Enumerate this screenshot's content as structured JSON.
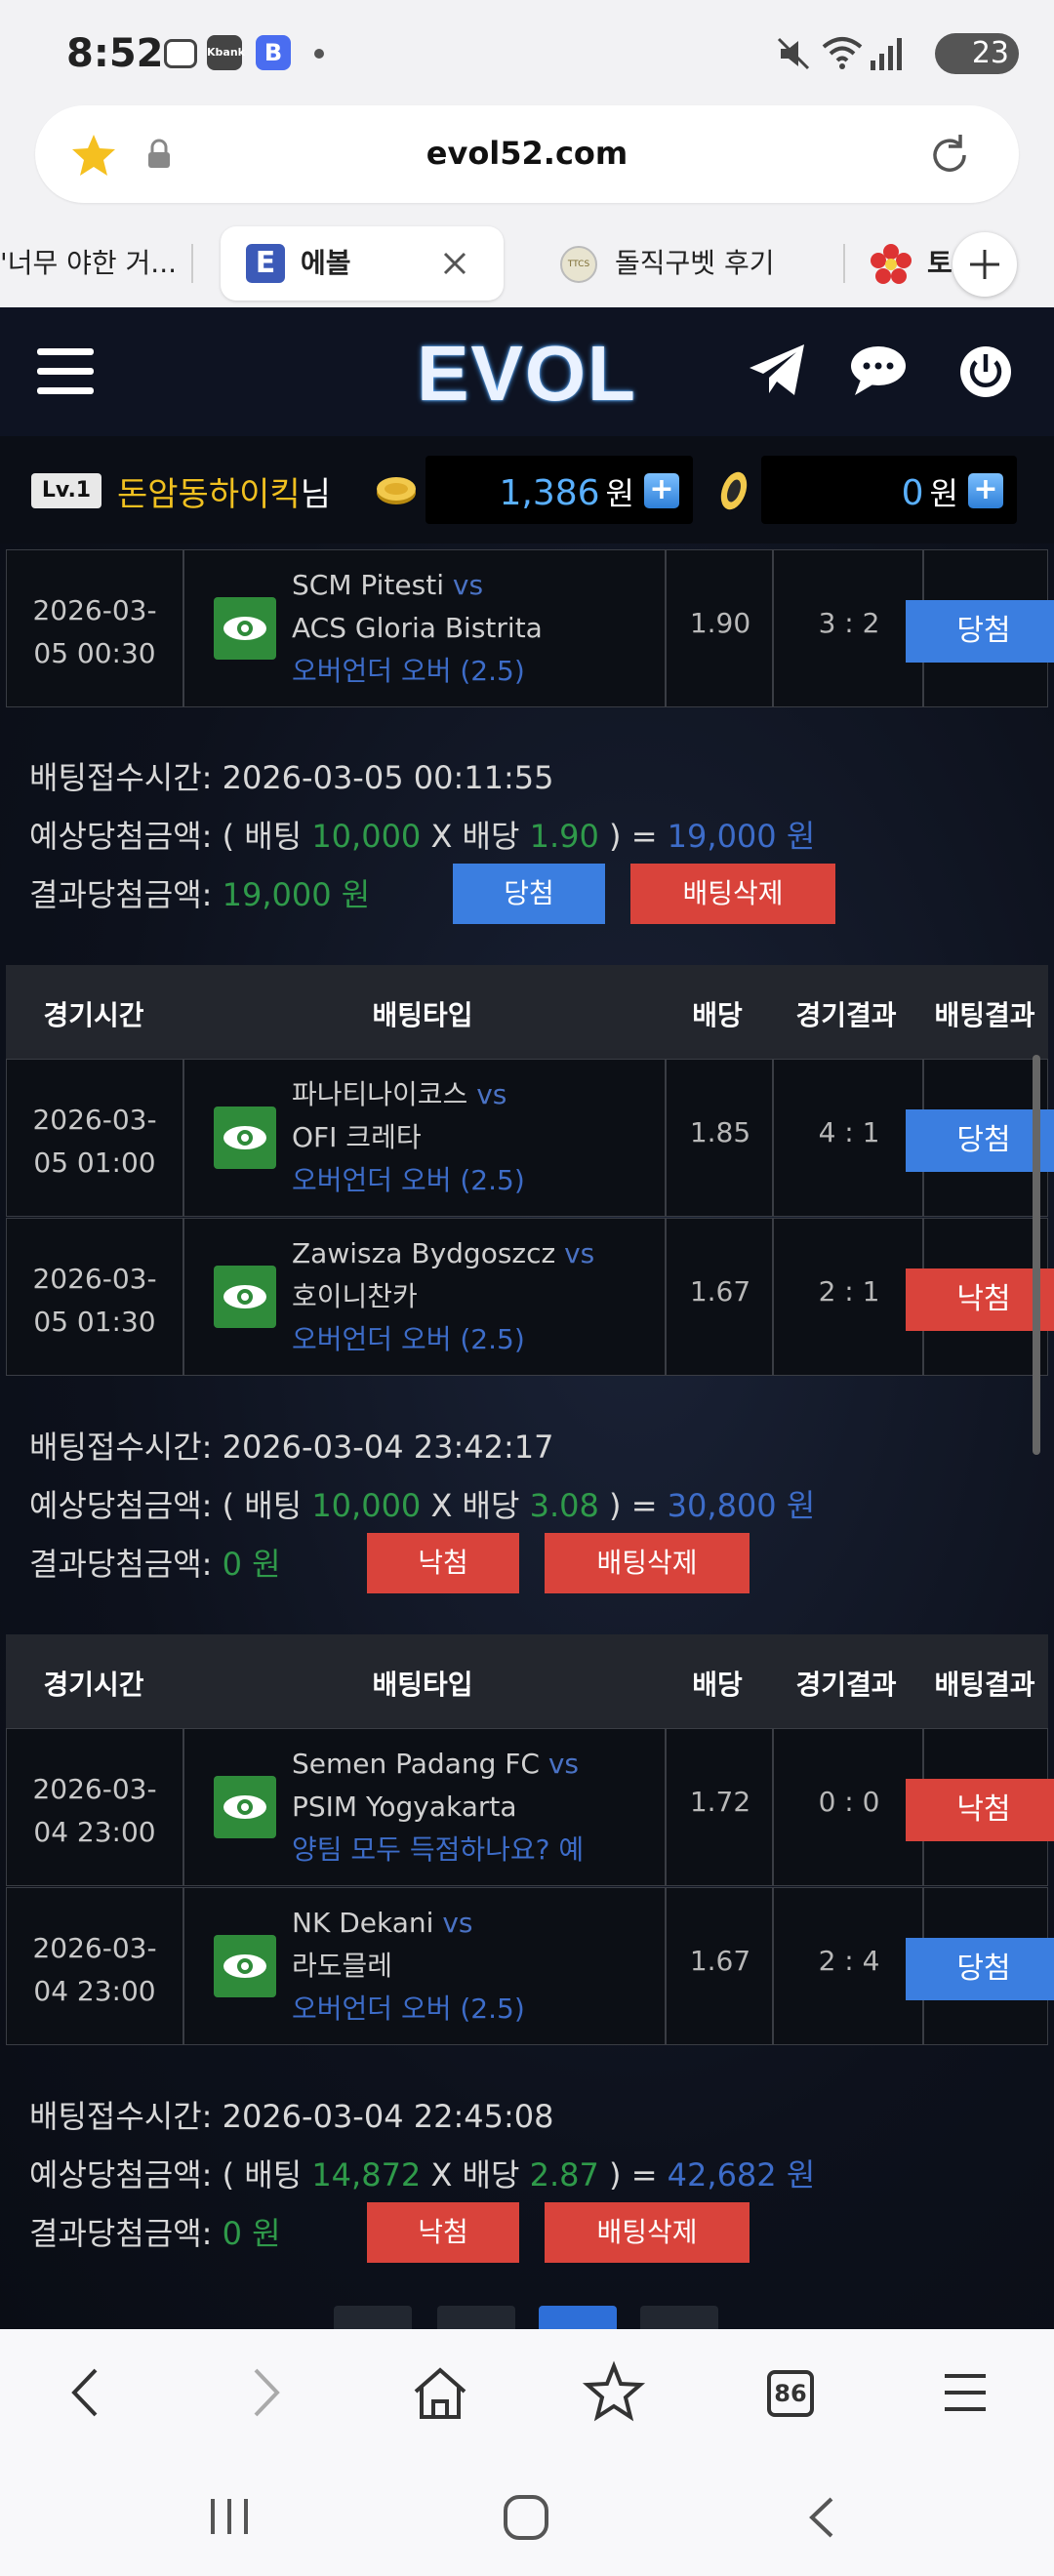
{
  "status_bar": {
    "time": "8:52",
    "kbank_label": "Kbank",
    "b_label": "B",
    "battery": "23"
  },
  "browser": {
    "url": "evol52.com",
    "tabs": [
      {
        "label": "'너무 야한 거..."
      },
      {
        "label": "에볼",
        "favicon": "E",
        "active": true
      },
      {
        "label": "돌직구벳 후기",
        "favicon": "TTCS"
      },
      {
        "label": "토"
      }
    ]
  },
  "site": {
    "logo": "EVOL"
  },
  "user": {
    "level": "Lv.1",
    "name": "돈암동하이킥",
    "suffix": "님",
    "money": "1,386",
    "money_unit": "원",
    "point": "0",
    "point_unit": "원"
  },
  "headers": {
    "time": "경기시간",
    "type": "배팅타입",
    "odds": "배당",
    "game_result": "경기결과",
    "bet_result": "배팅결과"
  },
  "groups": [
    {
      "rows": [
        {
          "date": "2026-03-",
          "time": "05 00:30",
          "home": "SCM Pitesti",
          "vs": "vs",
          "away": "ACS Gloria Bistrita",
          "bet": "오버언더 오버 (2.5)",
          "odds": "1.90",
          "score": "3 : 2",
          "result": "당첨"
        }
      ],
      "summary": {
        "accept_label": "배팅접수시간:",
        "accept_time": "2026-03-05 00:11:55",
        "expect_label": "예상당첨금액:",
        "open": "(",
        "bet_label": "배팅",
        "bet_amount": "10,000",
        "times": "X",
        "odds_label": "배당",
        "odds": "1.90",
        "close": ")",
        "eq": "=",
        "expect_amount": "19,000 원",
        "result_label": "결과당첨금액:",
        "result_amount": "19,000 원",
        "status_button": "당첨",
        "delete_button": "배팅삭제"
      }
    },
    {
      "rows": [
        {
          "date": "2026-03-",
          "time": "05 01:00",
          "home": "파나티나이코스",
          "vs": "vs",
          "away": "OFI 크레타",
          "bet": "오버언더 오버 (2.5)",
          "odds": "1.85",
          "score": "4 : 1",
          "result": "당첨"
        },
        {
          "date": "2026-03-",
          "time": "05 01:30",
          "home": "Zawisza Bydgoszcz",
          "vs": "vs",
          "away": "호이니찬카",
          "bet": "오버언더 오버 (2.5)",
          "odds": "1.67",
          "score": "2 : 1",
          "result": "낙첨"
        }
      ],
      "summary": {
        "accept_label": "배팅접수시간:",
        "accept_time": "2026-03-04 23:42:17",
        "expect_label": "예상당첨금액:",
        "open": "(",
        "bet_label": "배팅",
        "bet_amount": "10,000",
        "times": "X",
        "odds_label": "배당",
        "odds": "3.08",
        "close": ")",
        "eq": "=",
        "expect_amount": "30,800 원",
        "result_label": "결과당첨금액:",
        "result_amount": "0 원",
        "status_button": "낙첨",
        "delete_button": "배팅삭제"
      }
    },
    {
      "rows": [
        {
          "date": "2026-03-",
          "time": "04 23:00",
          "home": "Semen Padang FC",
          "vs": "vs",
          "away": "PSIM Yogyakarta",
          "bet": "양팀 모두 득점하나요? 예",
          "odds": "1.72",
          "score": "0 : 0",
          "result": "낙첨"
        },
        {
          "date": "2026-03-",
          "time": "04 23:00",
          "home": "NK Dekani",
          "vs": "vs",
          "away": "라도믈레",
          "bet": "오버언더 오버 (2.5)",
          "odds": "1.67",
          "score": "2 : 4",
          "result": "당첨"
        }
      ],
      "summary": {
        "accept_label": "배팅접수시간:",
        "accept_time": "2026-03-04 22:45:08",
        "expect_label": "예상당첨금액:",
        "open": "(",
        "bet_label": "배팅",
        "bet_amount": "14,872",
        "times": "X",
        "odds_label": "배당",
        "odds": "2.87",
        "close": ")",
        "eq": "=",
        "expect_amount": "42,682 원",
        "result_label": "결과당첨금액:",
        "result_amount": "0 원",
        "status_button": "낙첨",
        "delete_button": "배팅삭제"
      }
    }
  ],
  "bottom_nav": {
    "tabs_count": "86"
  },
  "colors": {
    "win": "#3b7ee0",
    "lose": "#d9433b",
    "accent_blue": "#3d6cc8",
    "accent_green": "#2f9a4a",
    "username": "#f0c020"
  }
}
